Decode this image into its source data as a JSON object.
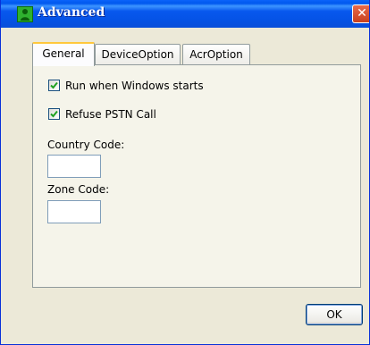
{
  "window": {
    "title": "Advanced",
    "close_symbol": "✕",
    "icon": "green-user-icon"
  },
  "tabs": [
    {
      "label": "General",
      "active": true
    },
    {
      "label": "DeviceOption",
      "active": false
    },
    {
      "label": "AcrOption",
      "active": false
    }
  ],
  "general": {
    "run_on_startup": {
      "label": "Run when Windows starts",
      "checked": true
    },
    "refuse_pstn": {
      "label": "Refuse PSTN Call",
      "checked": true
    },
    "country_code": {
      "label": "Country Code:",
      "value": ""
    },
    "zone_code": {
      "label": "Zone Code:",
      "value": ""
    }
  },
  "buttons": {
    "ok_label": "OK"
  },
  "colors": {
    "titlebar": "#0058EE",
    "dialog_bg": "#ECE9D8",
    "panel_bg": "#F5F4EA",
    "check_mark": "#21A121",
    "close_button": "#D9532F"
  }
}
